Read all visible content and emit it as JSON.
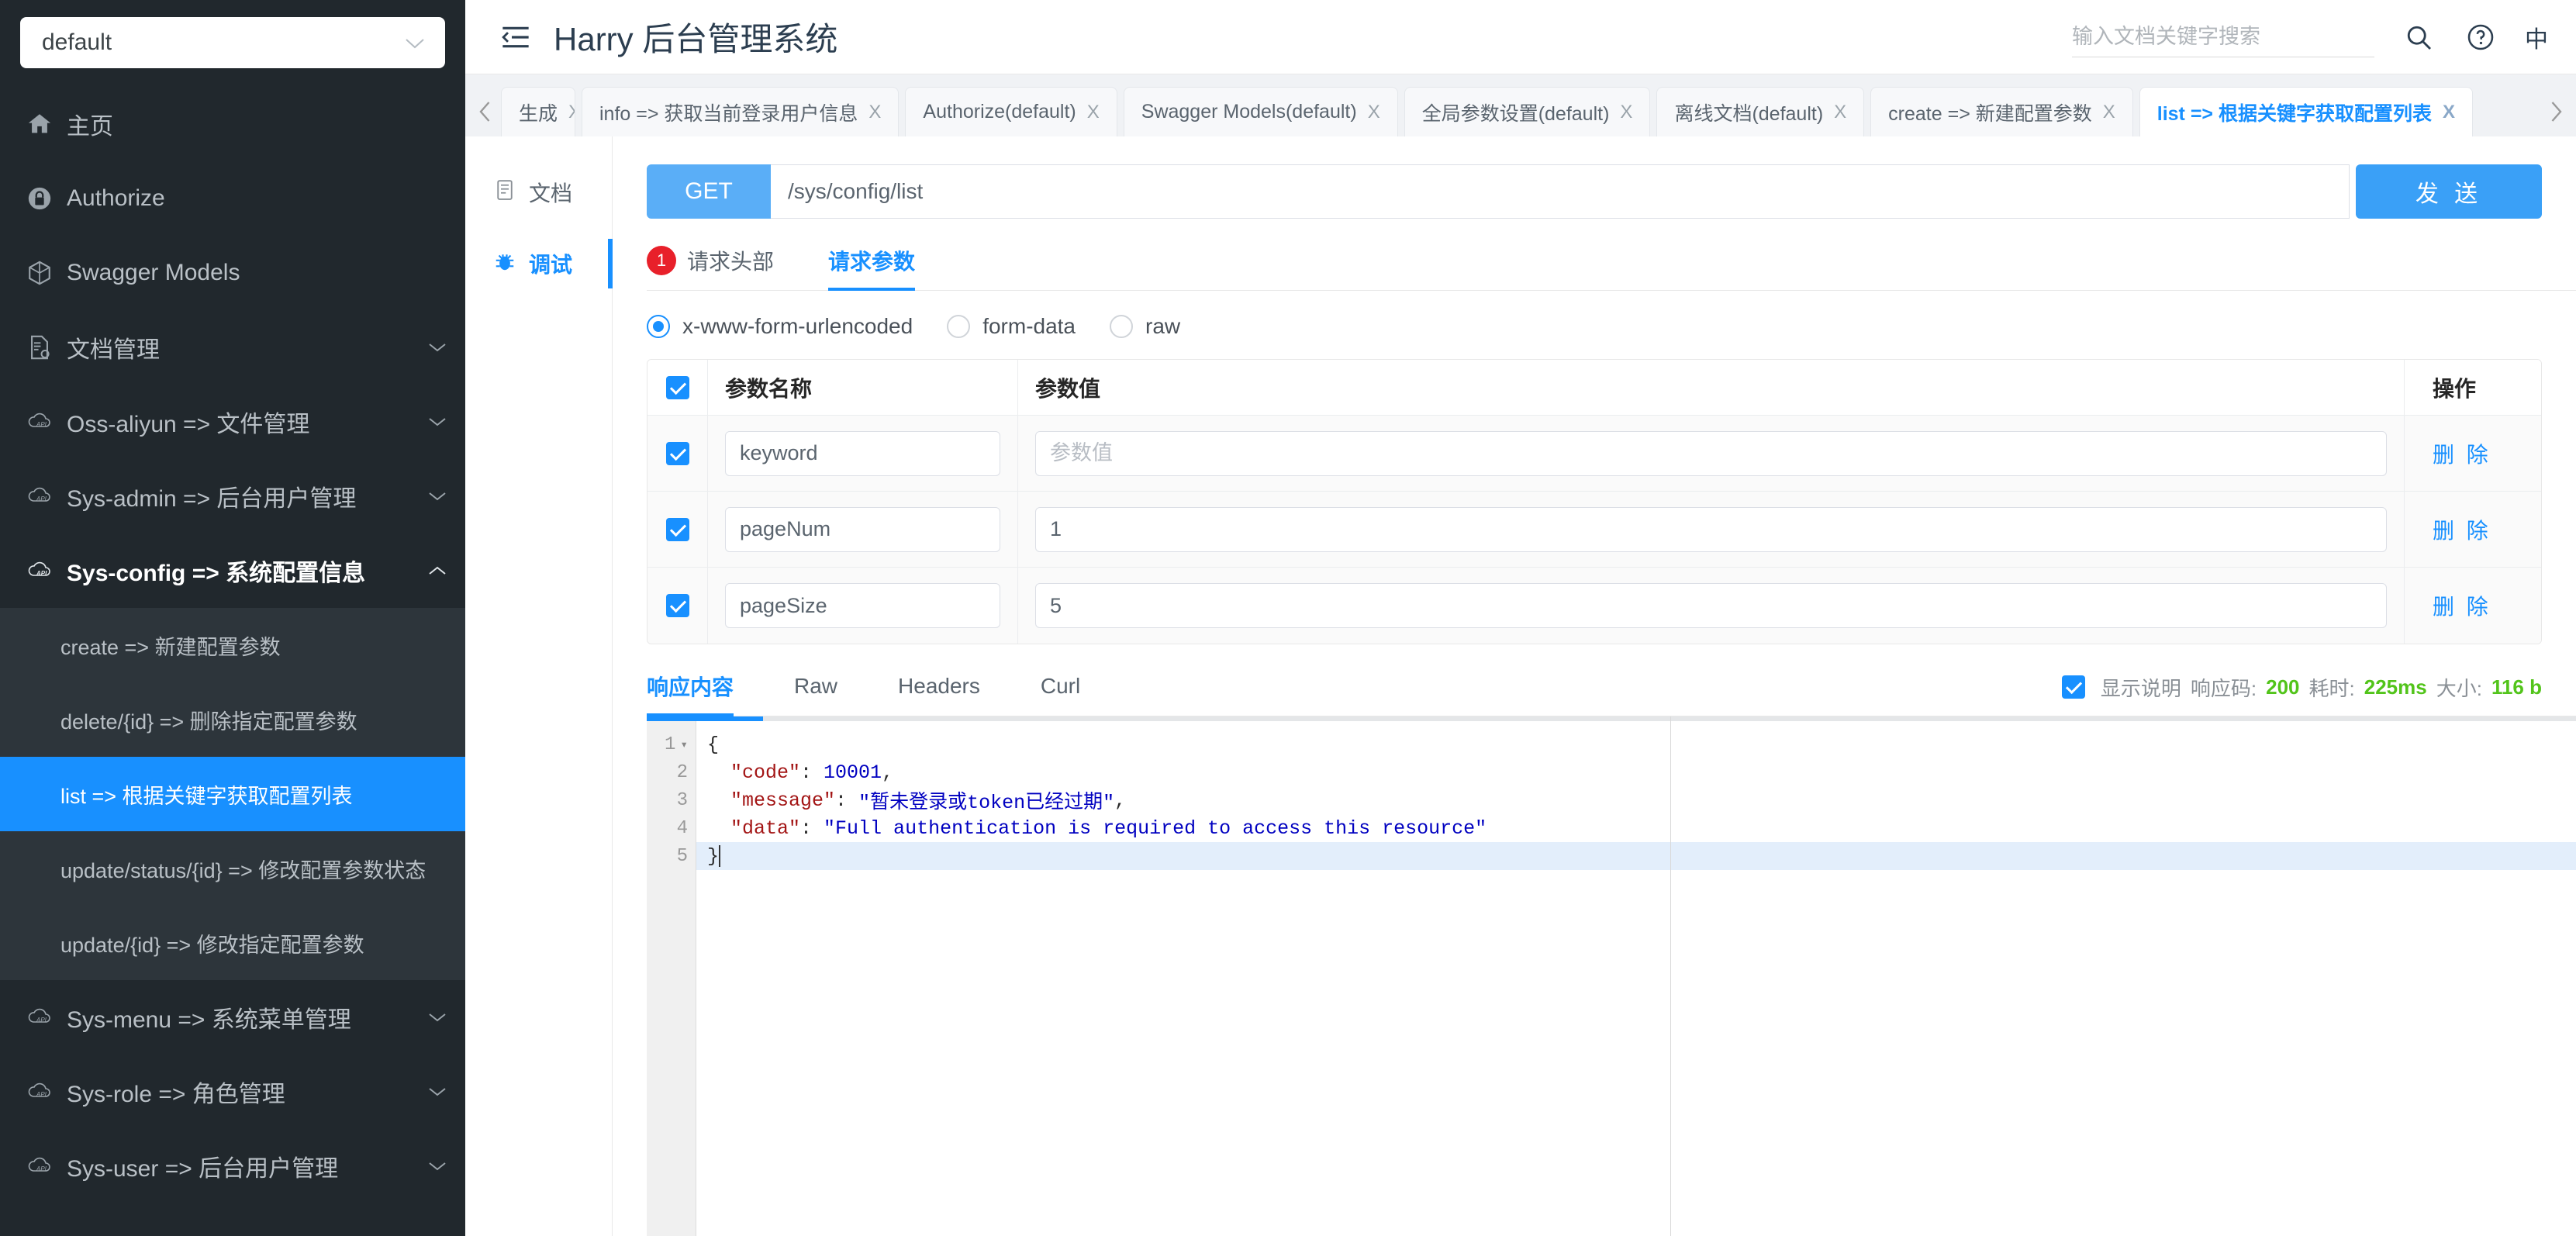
{
  "sidebar": {
    "project_select": {
      "value": "default",
      "icon": "chevron-down-icon"
    },
    "items": [
      {
        "label": "主页",
        "icon": "home-icon",
        "expandable": false
      },
      {
        "label": "Authorize",
        "icon": "lock-icon",
        "expandable": false
      },
      {
        "label": "Swagger Models",
        "icon": "cube-icon",
        "expandable": false
      },
      {
        "label": "文档管理",
        "icon": "document-gear-icon",
        "expandable": true
      },
      {
        "label": "Oss-aliyun => 文件管理",
        "icon": "api-cloud-icon",
        "expandable": true
      },
      {
        "label": "Sys-admin => 后台用户管理",
        "icon": "api-cloud-icon",
        "expandable": true
      },
      {
        "label": "Sys-config => 系统配置信息",
        "icon": "api-cloud-icon",
        "expandable": true,
        "expanded": true
      },
      {
        "label": "Sys-menu => 系统菜单管理",
        "icon": "api-cloud-icon",
        "expandable": true
      },
      {
        "label": "Sys-role => 角色管理",
        "icon": "api-cloud-icon",
        "expandable": true
      },
      {
        "label": "Sys-user => 后台用户管理",
        "icon": "api-cloud-icon",
        "expandable": true
      }
    ],
    "submenu": [
      {
        "label": "create => 新建配置参数",
        "selected": false
      },
      {
        "label": "delete/{id} => 删除指定配置参数",
        "selected": false
      },
      {
        "label": "list => 根据关键字获取配置列表",
        "selected": true
      },
      {
        "label": "update/status/{id} => 修改配置参数状态",
        "selected": false
      },
      {
        "label": "update/{id} => 修改指定配置参数",
        "selected": false
      }
    ],
    "selected_color": "#1890ff"
  },
  "header": {
    "collapse_icon": "menu-collapse-icon",
    "title": "Harry 后台管理系统",
    "search": {
      "value": "",
      "placeholder": "输入文档关键字搜索"
    },
    "search_icon": "search-icon",
    "help_icon": "question-circle-icon",
    "lang_label": "中"
  },
  "tabstrip": {
    "prev_icon": "chevron-left-icon",
    "next_icon": "chevron-right-icon",
    "close_glyph": "X",
    "tabs": [
      {
        "label": "生成",
        "active": false,
        "clipped": true
      },
      {
        "label": "info => 获取当前登录用户信息",
        "active": false
      },
      {
        "label": "Authorize(default)",
        "active": false
      },
      {
        "label": "Swagger Models(default)",
        "active": false
      },
      {
        "label": "全局参数设置(default)",
        "active": false
      },
      {
        "label": "离线文档(default)",
        "active": false
      },
      {
        "label": "create => 新建配置参数",
        "active": false
      },
      {
        "label": "list => 根据关键字获取配置列表",
        "active": true
      }
    ]
  },
  "docnav": {
    "items": [
      {
        "label": "文档",
        "icon": "doc-icon",
        "active": false
      },
      {
        "label": "调试",
        "icon": "bug-icon",
        "active": true
      }
    ]
  },
  "request": {
    "method": "GET",
    "url": "/sys/config/list",
    "send_label": "发 送",
    "tabs": [
      {
        "label": "请求头部",
        "badge": "1",
        "active": false
      },
      {
        "label": "请求参数",
        "badge": null,
        "active": true
      }
    ],
    "body_types": [
      {
        "label": "x-www-form-urlencoded",
        "selected": true
      },
      {
        "label": "form-data",
        "selected": false
      },
      {
        "label": "raw",
        "selected": false
      }
    ],
    "table": {
      "headers": {
        "name": "参数名称",
        "value": "参数值",
        "op": "操作"
      },
      "header_checked": true,
      "value_placeholder": "参数值",
      "delete_label": "删 除",
      "rows": [
        {
          "checked": true,
          "name": "keyword",
          "value": "",
          "delete": "删 除"
        },
        {
          "checked": true,
          "name": "pageNum",
          "value": "1",
          "delete": "删 除"
        },
        {
          "checked": true,
          "name": "pageSize",
          "value": "5",
          "delete": "删 除"
        }
      ]
    }
  },
  "response": {
    "tabs": [
      {
        "label": "响应内容",
        "active": true
      },
      {
        "label": "Raw",
        "active": false
      },
      {
        "label": "Headers",
        "active": false
      },
      {
        "label": "Curl",
        "active": false
      }
    ],
    "show_desc_checked": true,
    "show_desc_label": "显示说明",
    "meta": [
      {
        "key": "响应码:",
        "value": "200"
      },
      {
        "key": "耗时:",
        "value": "225ms"
      },
      {
        "key": "大小:",
        "value": "116 b"
      }
    ],
    "meta_value_color": "#52c41a",
    "editor": {
      "line_numbers": [
        "1",
        "2",
        "3",
        "4",
        "5"
      ],
      "fold_on_line": 1,
      "highlighted_line": 5,
      "lines": [
        [
          {
            "t": "{",
            "c": "pun"
          }
        ],
        [
          {
            "t": "  ",
            "c": "pun"
          },
          {
            "t": "\"code\"",
            "c": "key"
          },
          {
            "t": ": ",
            "c": "pun"
          },
          {
            "t": "10001",
            "c": "num"
          },
          {
            "t": ",",
            "c": "pun"
          }
        ],
        [
          {
            "t": "  ",
            "c": "pun"
          },
          {
            "t": "\"message\"",
            "c": "key"
          },
          {
            "t": ": ",
            "c": "pun"
          },
          {
            "t": "\"暂未登录或token已经过期\"",
            "c": "str"
          },
          {
            "t": ",",
            "c": "pun"
          }
        ],
        [
          {
            "t": "  ",
            "c": "pun"
          },
          {
            "t": "\"data\"",
            "c": "key"
          },
          {
            "t": ": ",
            "c": "pun"
          },
          {
            "t": "\"Full authentication is required to access this resource\"",
            "c": "str"
          }
        ],
        [
          {
            "t": "}",
            "c": "pun"
          }
        ]
      ]
    }
  }
}
